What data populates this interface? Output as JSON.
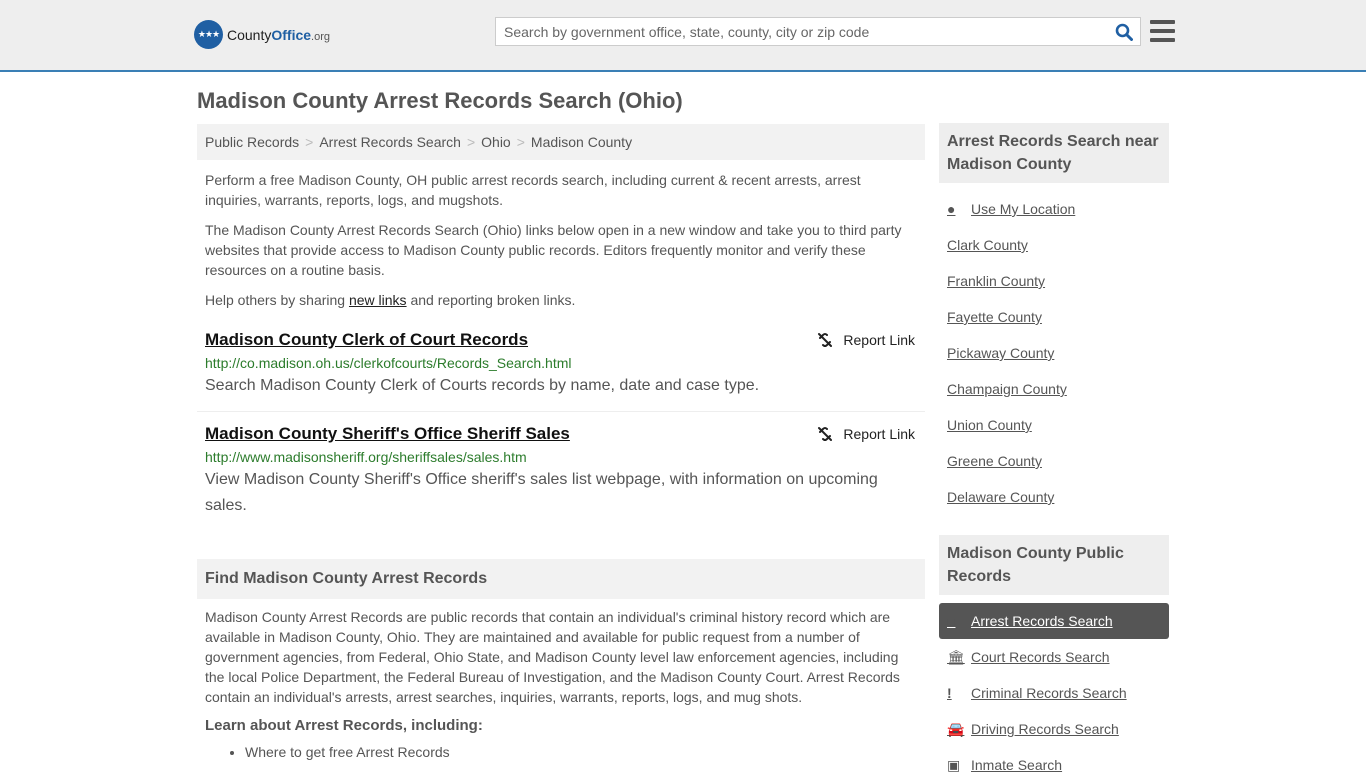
{
  "header": {
    "logo_name": "County",
    "logo_office": "Office",
    "logo_tld": ".org",
    "search_placeholder": "Search by government office, state, county, city or zip code"
  },
  "page_title": "Madison County Arrest Records Search (Ohio)",
  "breadcrumb": [
    "Public Records",
    "Arrest Records Search",
    "Ohio",
    "Madison County"
  ],
  "intro": {
    "p1": "Perform a free Madison County, OH public arrest records search, including current & recent arrests, arrest inquiries, warrants, reports, logs, and mugshots.",
    "p2": "The Madison County Arrest Records Search (Ohio) links below open in a new window and take you to third party websites that provide access to Madison County public records. Editors frequently monitor and verify these resources on a routine basis.",
    "p3_before": "Help others by sharing ",
    "p3_link": "new links",
    "p3_after": " and reporting broken links."
  },
  "records": [
    {
      "title": "Madison County Clerk of Court Records",
      "url": "http://co.madison.oh.us/clerkofcourts/Records_Search.html",
      "desc": "Search Madison County Clerk of Courts records by name, date and case type.",
      "report": "Report Link"
    },
    {
      "title": "Madison County Sheriff's Office Sheriff Sales",
      "url": "http://www.madisonsheriff.org/sheriffsales/sales.htm",
      "desc": "View Madison County Sheriff's Office sheriff's sales list webpage, with information on upcoming sales.",
      "report": "Report Link"
    }
  ],
  "find_section": {
    "heading": "Find Madison County Arrest Records",
    "body": "Madison County Arrest Records are public records that contain an individual's criminal history record which are available in Madison County, Ohio. They are maintained and available for public request from a number of government agencies, from Federal, Ohio State, and Madison County level law enforcement agencies, including the local Police Department, the Federal Bureau of Investigation, and the Madison County Court. Arrest Records contain an individual's arrests, arrest searches, inquiries, warrants, reports, logs, and mug shots.",
    "learn": "Learn about Arrest Records, including:",
    "bullets": [
      "Where to get free Arrest Records"
    ]
  },
  "sidebar": {
    "nearby_heading": "Arrest Records Search near Madison County",
    "use_location": "Use My Location",
    "nearby": [
      "Clark County",
      "Franklin County",
      "Fayette County",
      "Pickaway County",
      "Champaign County",
      "Union County",
      "Greene County",
      "Delaware County"
    ],
    "public_heading": "Madison County Public Records",
    "public": [
      {
        "label": "Arrest Records Search",
        "icon": "square-icon",
        "active": true
      },
      {
        "label": "Court Records Search",
        "icon": "courthouse-icon"
      },
      {
        "label": "Criminal Records Search",
        "icon": "exclamation-icon"
      },
      {
        "label": "Driving Records Search",
        "icon": "car-icon"
      },
      {
        "label": "Inmate Search",
        "icon": "jail-icon"
      }
    ]
  }
}
